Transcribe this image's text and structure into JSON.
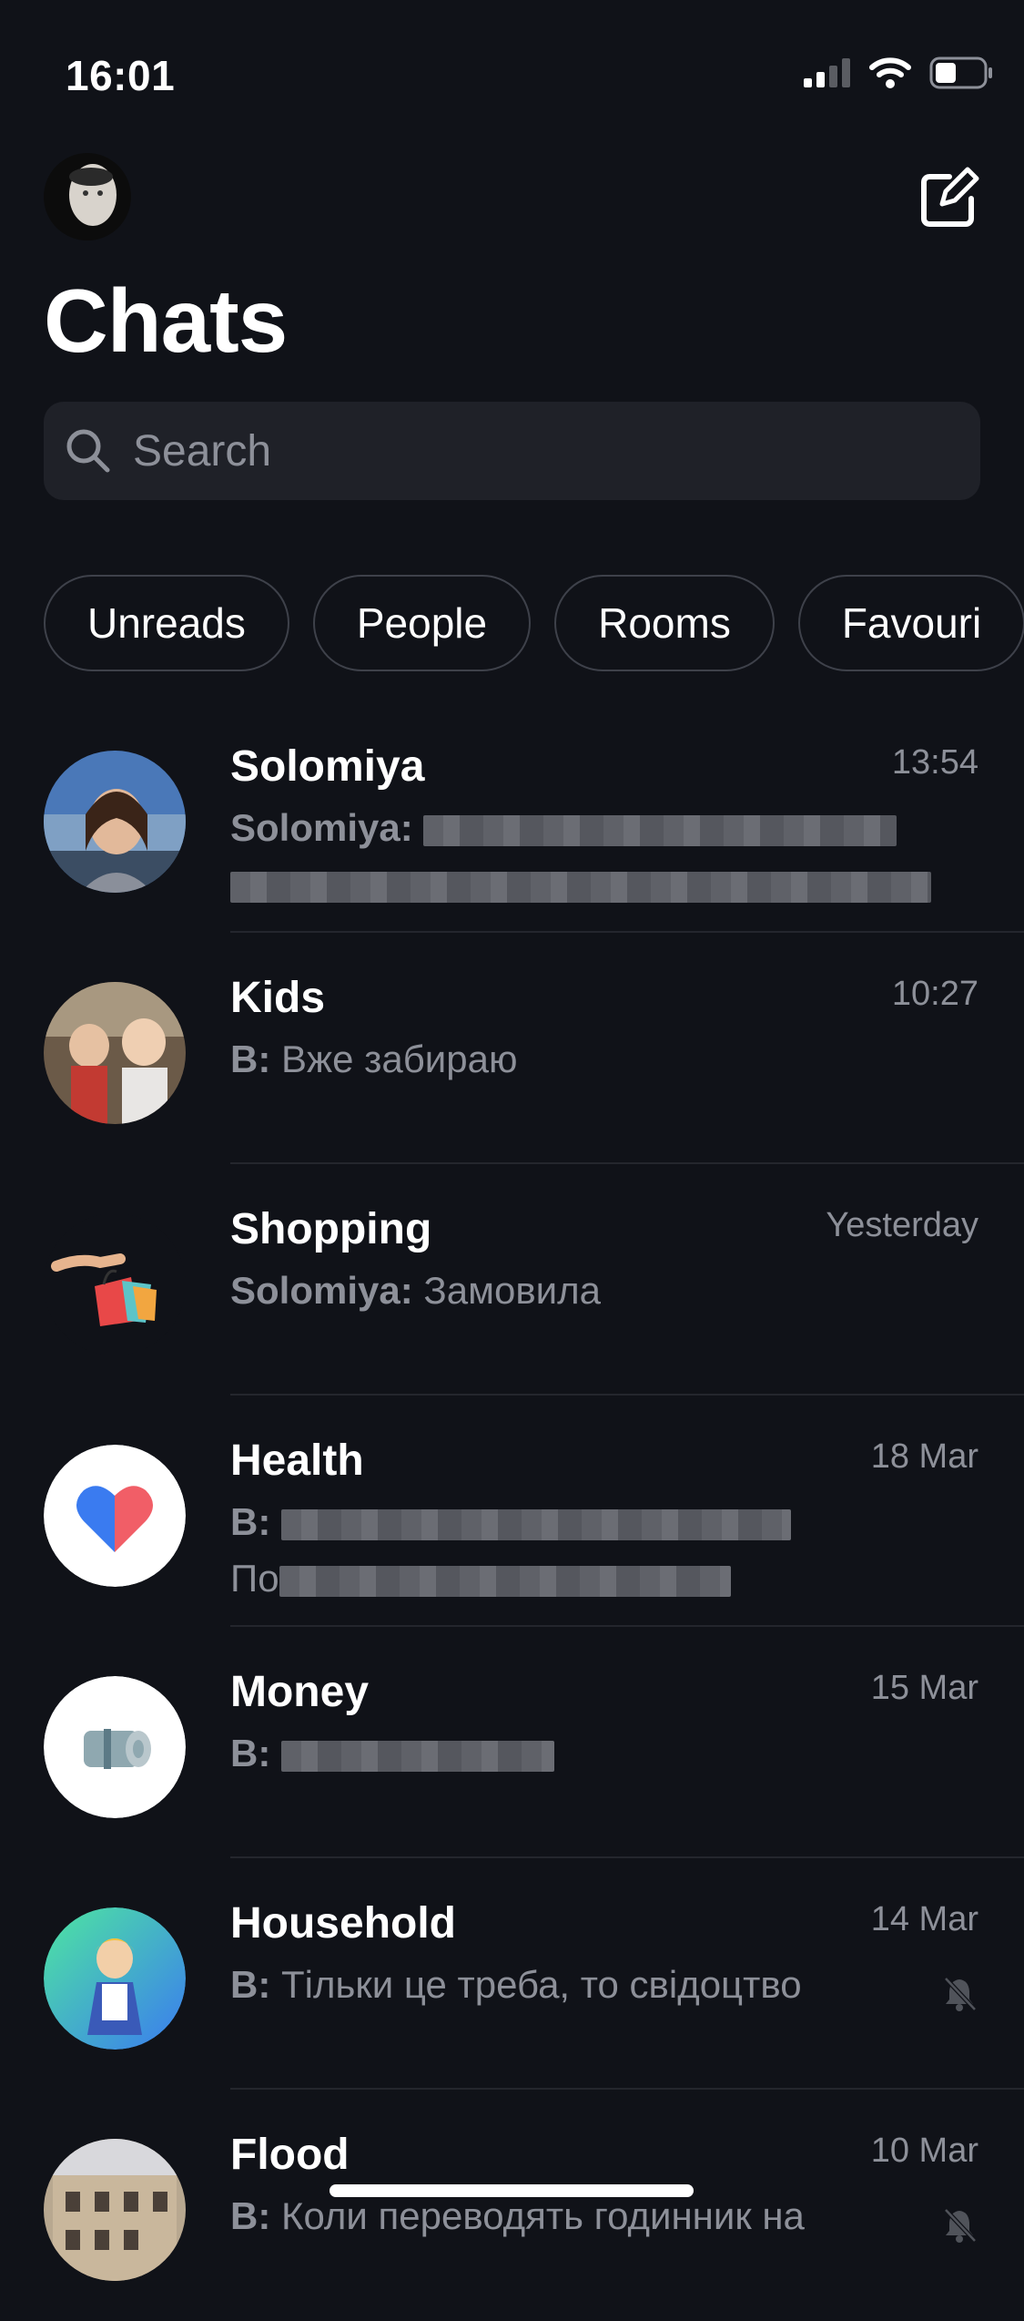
{
  "status": {
    "time": "16:01"
  },
  "header": {
    "title": "Chats"
  },
  "search": {
    "placeholder": "Search"
  },
  "filters": [
    {
      "label": "Unreads"
    },
    {
      "label": "People"
    },
    {
      "label": "Rooms"
    },
    {
      "label": "Favouri"
    }
  ],
  "chats": [
    {
      "name": "Solomiya",
      "time": "13:54",
      "sender": "Solomiya:",
      "preview": ""
    },
    {
      "name": "Kids",
      "time": "10:27",
      "sender": "B:",
      "preview": "Вже забираю"
    },
    {
      "name": "Shopping",
      "time": "Yesterday",
      "sender": "Solomiya:",
      "preview": "Замовила"
    },
    {
      "name": "Health",
      "time": "18 Mar",
      "sender": "B:",
      "preview": "По"
    },
    {
      "name": "Money",
      "time": "15 Mar",
      "sender": "B:",
      "preview": ""
    },
    {
      "name": "Household",
      "time": "14 Mar",
      "sender": "B:",
      "preview": "Тільки це треба, то свідоцтво",
      "muted": true
    },
    {
      "name": "Flood",
      "time": "10 Mar",
      "sender": "B:",
      "preview": "Коли переводять годинник на",
      "muted": true
    }
  ],
  "colors": {
    "background": "#101218",
    "muted_text": "#8d9099",
    "search_bg": "#1f2128",
    "heart_blue": "#3a7bf0",
    "heart_red": "#f0505a"
  }
}
